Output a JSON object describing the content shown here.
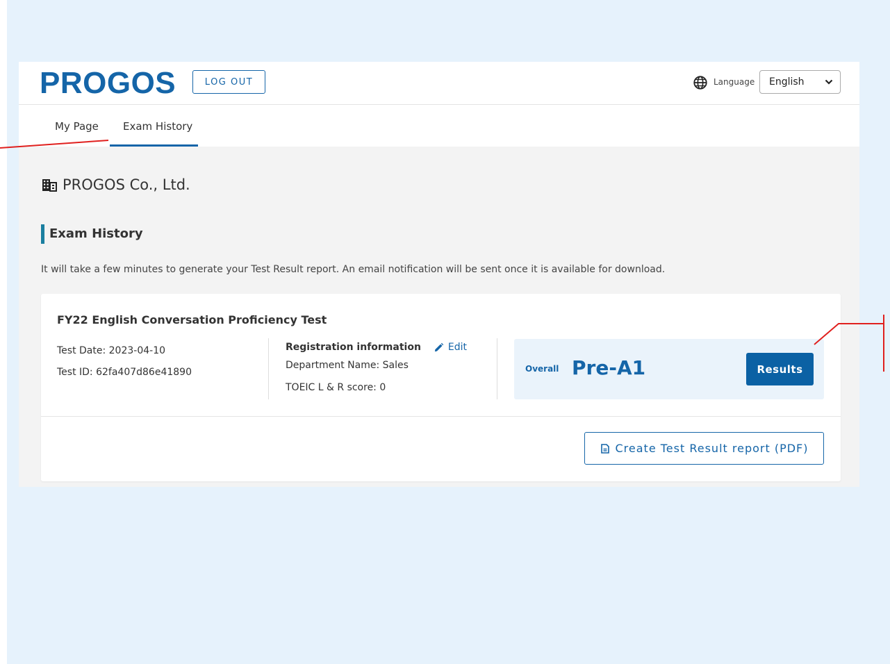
{
  "header": {
    "logo": "PROGOS",
    "logout_label": "LOG OUT",
    "language_label": "Language",
    "language_selected": "English"
  },
  "tabs": [
    {
      "label": "My Page",
      "active": false
    },
    {
      "label": "Exam History",
      "active": true
    }
  ],
  "company": {
    "name": "PROGOS Co., Ltd."
  },
  "section": {
    "title": "Exam History",
    "notice": "It will take a few minutes to generate your Test Result report. An email notification will be sent once it is available for download."
  },
  "exam": {
    "title": "FY22 English Conversation Proficiency Test",
    "test_date": "Test Date: 2023-04-10",
    "test_id": "Test ID: 62fa407d86e41890",
    "registration_label": "Registration information",
    "edit_label": "Edit",
    "department": "Department Name: Sales",
    "toeic": "TOEIC L & R score: 0",
    "overall_label": "Overall",
    "overall_level": "Pre-A1",
    "results_label": "Results",
    "pdf_label": "Create Test Result report (PDF)"
  },
  "colors": {
    "brand": "#1565a8",
    "accent_bar": "#1a7fa0",
    "annotation": "#e0201e",
    "background": "#e6f2fc"
  },
  "icons": {
    "language": "globe-icon",
    "company": "building-icon",
    "edit": "pencil-icon",
    "pdf": "document-icon",
    "select": "chevron-down-icon"
  }
}
